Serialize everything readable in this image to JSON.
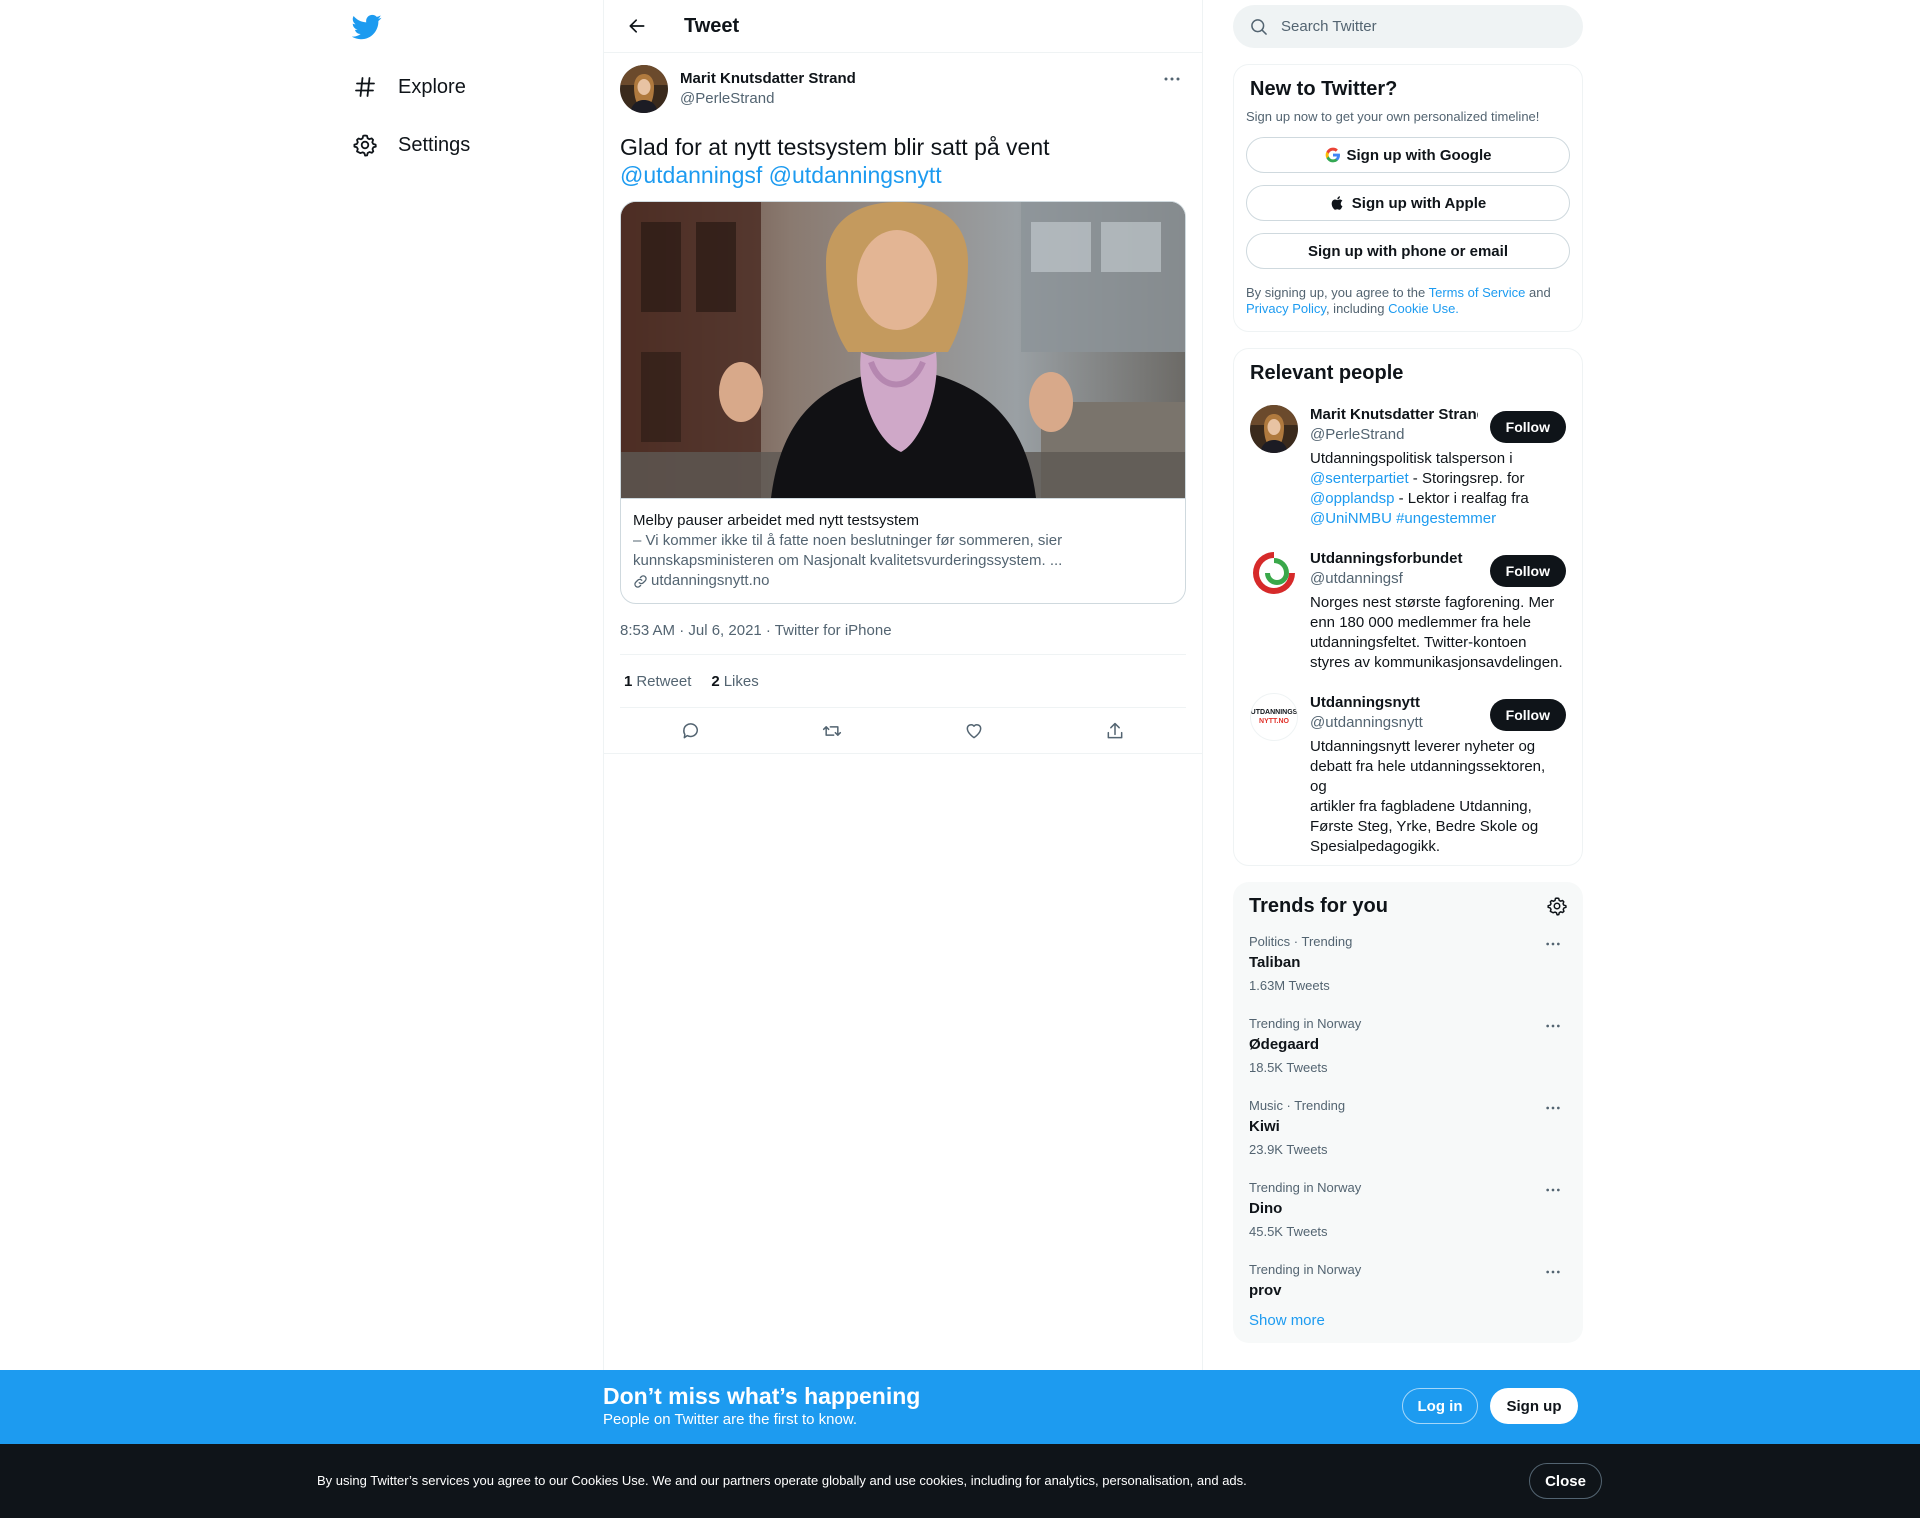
{
  "nav": {
    "items": [
      {
        "label": "Explore",
        "icon": "hashtag-icon"
      },
      {
        "label": "Settings",
        "icon": "gear-icon"
      }
    ]
  },
  "header": {
    "title": "Tweet"
  },
  "tweet": {
    "author_name": "Marit Knutsdatter Strand",
    "author_handle": "@PerleStrand",
    "text_line1": "Glad for at nytt testsystem blir satt på vent",
    "mention1": "@utdanningsf",
    "mention2": "@utdanningsnytt",
    "card": {
      "title": "Melby pauser arbeidet med nytt testsystem",
      "description_line1": "– Vi kommer ikke til å fatte noen beslutninger før sommeren, sier",
      "description_line2": "kunnskapsministeren om Nasjonalt kvalitetsvurderingssystem. ...",
      "domain": "utdanningsnytt.no"
    },
    "timestamp": "8:53 AM · Jul 6, 2021 · Twitter for iPhone",
    "retweets_count": "1",
    "retweets_label": "Retweet",
    "likes_count": "2",
    "likes_label": "Likes"
  },
  "search": {
    "placeholder": "Search Twitter"
  },
  "new_to_twitter": {
    "title": "New to Twitter?",
    "subtitle": "Sign up now to get your own personalized timeline!",
    "google": "Sign up with Google",
    "apple": "Sign up with Apple",
    "phone": "Sign up with phone or email",
    "terms_pre": "By signing up, you agree to the ",
    "terms_link": "Terms of Service",
    "terms_and": " and",
    "privacy_link": "Privacy Policy",
    "terms_including": ", including ",
    "cookie_link": "Cookie Use."
  },
  "relevant_people": {
    "title": "Relevant people",
    "follow_label": "Follow",
    "people": [
      {
        "name": "Marit Knutsdatter Strand",
        "handle": "@PerleStrand",
        "bio_1": "Utdanningspolitisk talsperson i",
        "bio_2a": "@senterpartiet",
        "bio_2b": " - Storingsrep. for",
        "bio_3a": "@opplandsp",
        "bio_3b": " - Lektor i realfag fra",
        "bio_4a": "@UniNMBU",
        "bio_4b": "#ungestemmer"
      },
      {
        "name": "Utdanningsforbundet",
        "handle": "@utdanningsf",
        "bio_1": "Norges nest største fagforening. Mer",
        "bio_2": "enn 180 000 medlemmer fra hele",
        "bio_3": "utdanningsfeltet. Twitter-kontoen",
        "bio_4": "styres av kommunikasjonsavdelingen."
      },
      {
        "name": "Utdanningsnytt",
        "handle": "@utdanningsnytt",
        "logo_top": "UTDANNINGS",
        "logo_bottom": "NYTT.NO",
        "bio_1": "Utdanningsnytt leverer nyheter og",
        "bio_2": "debatt fra hele utdanningssektoren, og",
        "bio_3": "artikler fra fagbladene Utdanning,",
        "bio_4": "Første Steg, Yrke, Bedre Skole og",
        "bio_5": "Spesialpedagogikk."
      }
    ]
  },
  "trends": {
    "title": "Trends for you",
    "items": [
      {
        "meta": "Politics · Trending",
        "name": "Taliban",
        "count": "1.63M Tweets"
      },
      {
        "meta": "Trending in Norway",
        "name": "Ødegaard",
        "count": "18.5K Tweets"
      },
      {
        "meta": "Music · Trending",
        "name": "Kiwi",
        "count": "23.9K Tweets"
      },
      {
        "meta": "Trending in Norway",
        "name": "Dino",
        "count": "45.5K Tweets"
      },
      {
        "meta": "Trending in Norway",
        "name": "prov",
        "count": ""
      }
    ],
    "show_more": "Show more"
  },
  "banner": {
    "title": "Don’t miss what’s happening",
    "subtitle": "People on Twitter are the first to know.",
    "login": "Log in",
    "signup": "Sign up"
  },
  "cookie": {
    "text": "By using Twitter’s services you agree to our Cookies Use. We and our partners operate globally and use cookies, including for analytics, personalisation, and ads.",
    "close": "Close"
  },
  "colors": {
    "accent": "#1d9bf0",
    "text": "#0f1419",
    "muted": "#536471",
    "dark": "#0f1419"
  }
}
